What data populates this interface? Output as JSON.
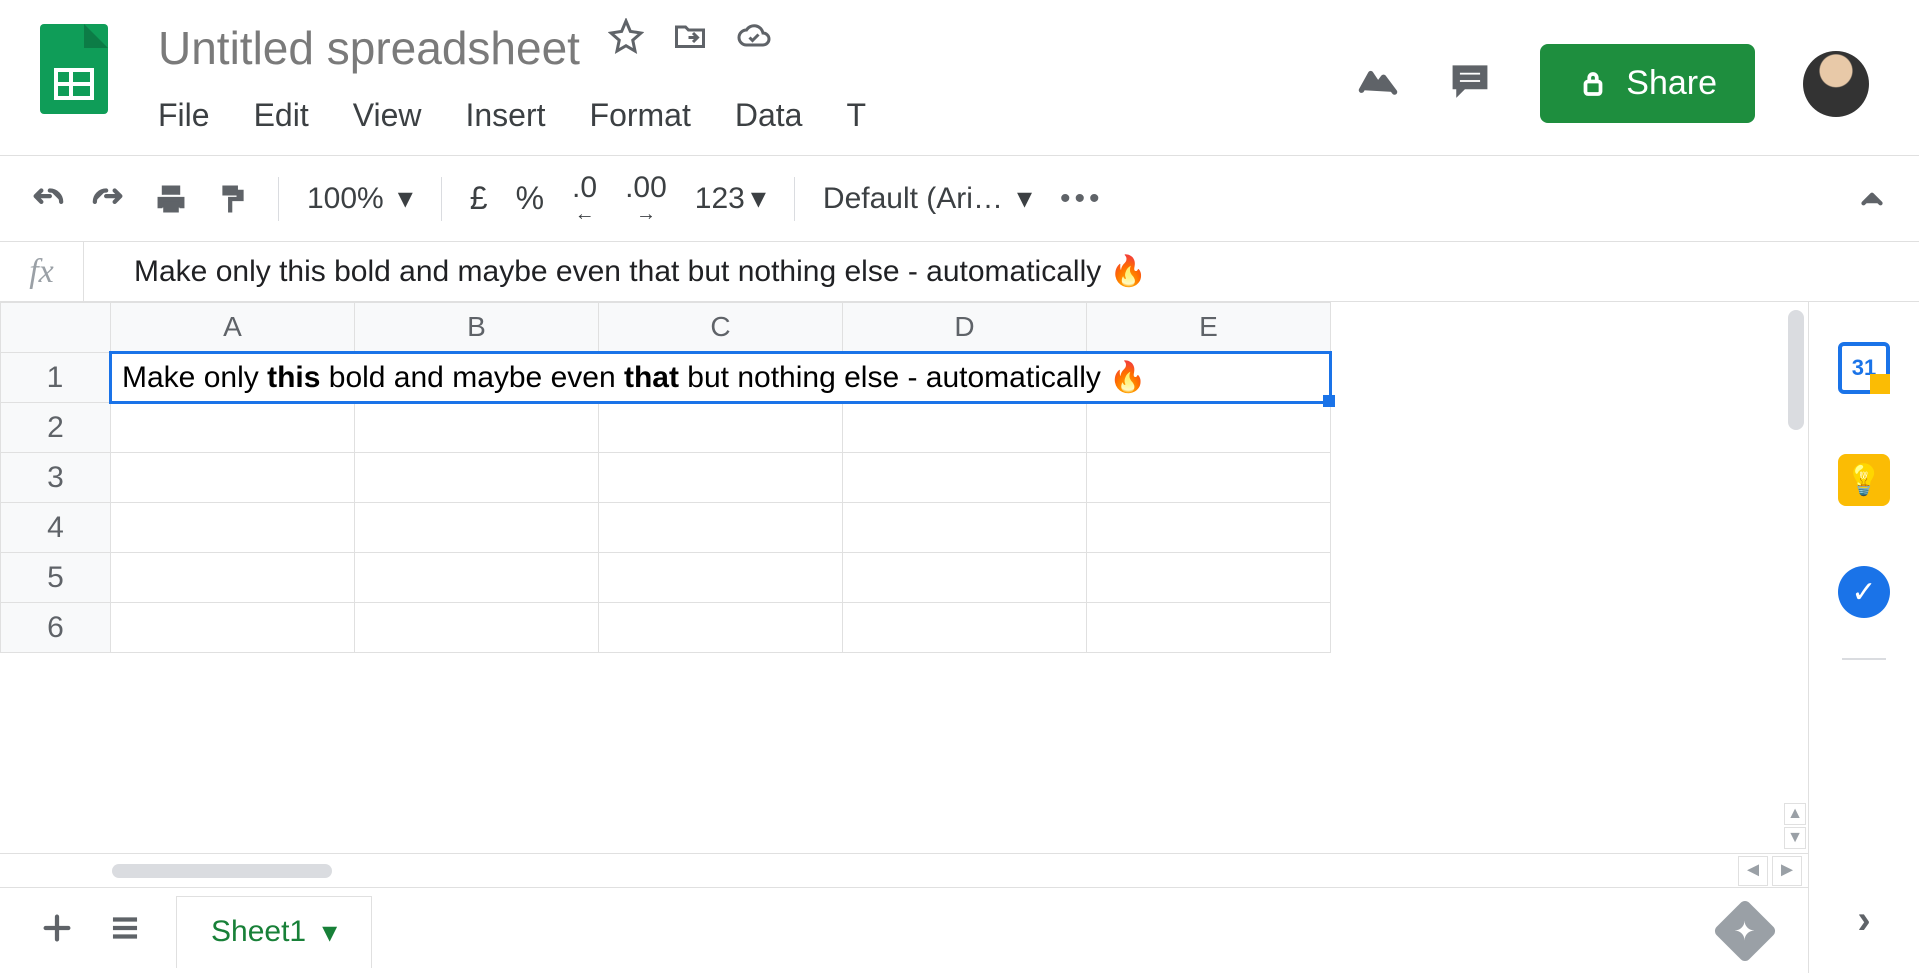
{
  "doc": {
    "title": "Untitled spreadsheet"
  },
  "menubar": {
    "file": "File",
    "edit": "Edit",
    "view": "View",
    "insert": "Insert",
    "format": "Format",
    "data": "Data",
    "tools_initial": "T"
  },
  "share": {
    "label": "Share"
  },
  "toolbar": {
    "zoom": "100%",
    "currency": "£",
    "percent": "%",
    "dec_less": ".0",
    "dec_more": ".00",
    "numfmt": "123",
    "font": "Default (Ari…"
  },
  "formula_bar": {
    "fx_label": "fx",
    "content": "Make only this bold and maybe even that but nothing else - automatically 🔥"
  },
  "grid": {
    "columns": [
      "A",
      "B",
      "C",
      "D",
      "E"
    ],
    "rows": [
      "1",
      "2",
      "3",
      "4",
      "5",
      "6"
    ],
    "active_cell": "A1",
    "cell_a1_parts": {
      "p1": "Make only ",
      "b1": "this",
      "p2": " bold and maybe even ",
      "b2": "that",
      "p3": " but nothing else - automatically 🔥"
    }
  },
  "tabs": {
    "sheet1": "Sheet1"
  },
  "sidepanel": {
    "calendar_day": "31"
  }
}
